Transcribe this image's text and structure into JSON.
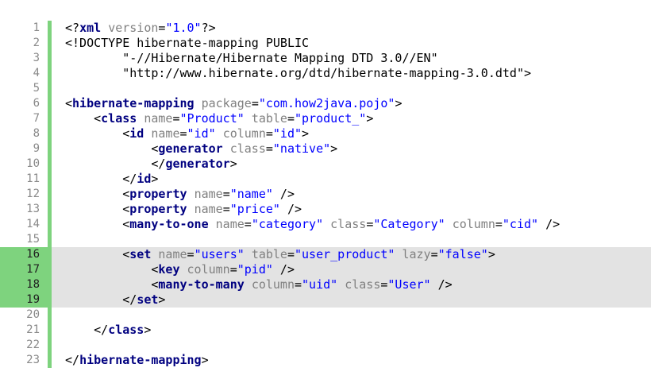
{
  "highlighted_lines": [
    16,
    17,
    18,
    19
  ],
  "colors": {
    "tag": "#000080",
    "attribute": "#808080",
    "value": "#0000ff",
    "punctuation": "#000000",
    "gutter_bar": "#7ed37e",
    "highlight_background": "#e3e3e3"
  },
  "lines": [
    {
      "n": "1",
      "tokens": [
        {
          "t": "<?",
          "c": "p"
        },
        {
          "t": "xml",
          "c": "k"
        },
        {
          "t": " ",
          "c": "p"
        },
        {
          "t": "version",
          "c": "a"
        },
        {
          "t": "=",
          "c": "p"
        },
        {
          "t": "\"1.0\"",
          "c": "v"
        },
        {
          "t": "?>",
          "c": "p"
        }
      ]
    },
    {
      "n": "2",
      "tokens": [
        {
          "t": "<!DOCTYPE hibernate-mapping PUBLIC",
          "c": "p"
        }
      ]
    },
    {
      "n": "3",
      "tokens": [
        {
          "t": "        \"-//Hibernate/Hibernate Mapping DTD 3.0//EN\"",
          "c": "p"
        }
      ]
    },
    {
      "n": "4",
      "tokens": [
        {
          "t": "        \"http://www.hibernate.org/dtd/hibernate-mapping-3.0.dtd\">",
          "c": "p"
        }
      ]
    },
    {
      "n": "5",
      "tokens": []
    },
    {
      "n": "6",
      "tokens": [
        {
          "t": "<",
          "c": "p"
        },
        {
          "t": "hibernate-mapping",
          "c": "k"
        },
        {
          "t": " ",
          "c": "p"
        },
        {
          "t": "package",
          "c": "a"
        },
        {
          "t": "=",
          "c": "p"
        },
        {
          "t": "\"com.how2java.pojo\"",
          "c": "v"
        },
        {
          "t": ">",
          "c": "p"
        }
      ]
    },
    {
      "n": "7",
      "tokens": [
        {
          "t": "    <",
          "c": "p"
        },
        {
          "t": "class",
          "c": "k"
        },
        {
          "t": " ",
          "c": "p"
        },
        {
          "t": "name",
          "c": "a"
        },
        {
          "t": "=",
          "c": "p"
        },
        {
          "t": "\"Product\"",
          "c": "v"
        },
        {
          "t": " ",
          "c": "p"
        },
        {
          "t": "table",
          "c": "a"
        },
        {
          "t": "=",
          "c": "p"
        },
        {
          "t": "\"product_\"",
          "c": "v"
        },
        {
          "t": ">",
          "c": "p"
        }
      ]
    },
    {
      "n": "8",
      "tokens": [
        {
          "t": "        <",
          "c": "p"
        },
        {
          "t": "id",
          "c": "k"
        },
        {
          "t": " ",
          "c": "p"
        },
        {
          "t": "name",
          "c": "a"
        },
        {
          "t": "=",
          "c": "p"
        },
        {
          "t": "\"id\"",
          "c": "v"
        },
        {
          "t": " ",
          "c": "p"
        },
        {
          "t": "column",
          "c": "a"
        },
        {
          "t": "=",
          "c": "p"
        },
        {
          "t": "\"id\"",
          "c": "v"
        },
        {
          "t": ">",
          "c": "p"
        }
      ]
    },
    {
      "n": "9",
      "tokens": [
        {
          "t": "            <",
          "c": "p"
        },
        {
          "t": "generator",
          "c": "k"
        },
        {
          "t": " ",
          "c": "p"
        },
        {
          "t": "class",
          "c": "a"
        },
        {
          "t": "=",
          "c": "p"
        },
        {
          "t": "\"native\"",
          "c": "v"
        },
        {
          "t": ">",
          "c": "p"
        }
      ]
    },
    {
      "n": "10",
      "tokens": [
        {
          "t": "            </",
          "c": "p"
        },
        {
          "t": "generator",
          "c": "k"
        },
        {
          "t": ">",
          "c": "p"
        }
      ]
    },
    {
      "n": "11",
      "tokens": [
        {
          "t": "        </",
          "c": "p"
        },
        {
          "t": "id",
          "c": "k"
        },
        {
          "t": ">",
          "c": "p"
        }
      ]
    },
    {
      "n": "12",
      "tokens": [
        {
          "t": "        <",
          "c": "p"
        },
        {
          "t": "property",
          "c": "k"
        },
        {
          "t": " ",
          "c": "p"
        },
        {
          "t": "name",
          "c": "a"
        },
        {
          "t": "=",
          "c": "p"
        },
        {
          "t": "\"name\"",
          "c": "v"
        },
        {
          "t": " />",
          "c": "p"
        }
      ]
    },
    {
      "n": "13",
      "tokens": [
        {
          "t": "        <",
          "c": "p"
        },
        {
          "t": "property",
          "c": "k"
        },
        {
          "t": " ",
          "c": "p"
        },
        {
          "t": "name",
          "c": "a"
        },
        {
          "t": "=",
          "c": "p"
        },
        {
          "t": "\"price\"",
          "c": "v"
        },
        {
          "t": " />",
          "c": "p"
        }
      ]
    },
    {
      "n": "14",
      "tokens": [
        {
          "t": "        <",
          "c": "p"
        },
        {
          "t": "many-to-one",
          "c": "k"
        },
        {
          "t": " ",
          "c": "p"
        },
        {
          "t": "name",
          "c": "a"
        },
        {
          "t": "=",
          "c": "p"
        },
        {
          "t": "\"category\"",
          "c": "v"
        },
        {
          "t": " ",
          "c": "p"
        },
        {
          "t": "class",
          "c": "a"
        },
        {
          "t": "=",
          "c": "p"
        },
        {
          "t": "\"Category\"",
          "c": "v"
        },
        {
          "t": " ",
          "c": "p"
        },
        {
          "t": "column",
          "c": "a"
        },
        {
          "t": "=",
          "c": "p"
        },
        {
          "t": "\"cid\"",
          "c": "v"
        },
        {
          "t": " />",
          "c": "p"
        }
      ]
    },
    {
      "n": "15",
      "tokens": []
    },
    {
      "n": "16",
      "tokens": [
        {
          "t": "        <",
          "c": "p"
        },
        {
          "t": "set",
          "c": "k"
        },
        {
          "t": " ",
          "c": "p"
        },
        {
          "t": "name",
          "c": "a"
        },
        {
          "t": "=",
          "c": "p"
        },
        {
          "t": "\"users\"",
          "c": "v"
        },
        {
          "t": " ",
          "c": "p"
        },
        {
          "t": "table",
          "c": "a"
        },
        {
          "t": "=",
          "c": "p"
        },
        {
          "t": "\"user_product\"",
          "c": "v"
        },
        {
          "t": " ",
          "c": "p"
        },
        {
          "t": "lazy",
          "c": "a"
        },
        {
          "t": "=",
          "c": "p"
        },
        {
          "t": "\"false\"",
          "c": "v"
        },
        {
          "t": ">",
          "c": "p"
        }
      ]
    },
    {
      "n": "17",
      "tokens": [
        {
          "t": "            <",
          "c": "p"
        },
        {
          "t": "key",
          "c": "k"
        },
        {
          "t": " ",
          "c": "p"
        },
        {
          "t": "column",
          "c": "a"
        },
        {
          "t": "=",
          "c": "p"
        },
        {
          "t": "\"pid\"",
          "c": "v"
        },
        {
          "t": " />",
          "c": "p"
        }
      ]
    },
    {
      "n": "18",
      "tokens": [
        {
          "t": "            <",
          "c": "p"
        },
        {
          "t": "many-to-many",
          "c": "k"
        },
        {
          "t": " ",
          "c": "p"
        },
        {
          "t": "column",
          "c": "a"
        },
        {
          "t": "=",
          "c": "p"
        },
        {
          "t": "\"uid\"",
          "c": "v"
        },
        {
          "t": " ",
          "c": "p"
        },
        {
          "t": "class",
          "c": "a"
        },
        {
          "t": "=",
          "c": "p"
        },
        {
          "t": "\"User\"",
          "c": "v"
        },
        {
          "t": " />",
          "c": "p"
        }
      ]
    },
    {
      "n": "19",
      "tokens": [
        {
          "t": "        </",
          "c": "p"
        },
        {
          "t": "set",
          "c": "k"
        },
        {
          "t": ">",
          "c": "p"
        }
      ]
    },
    {
      "n": "20",
      "tokens": []
    },
    {
      "n": "21",
      "tokens": [
        {
          "t": "    </",
          "c": "p"
        },
        {
          "t": "class",
          "c": "k"
        },
        {
          "t": ">",
          "c": "p"
        }
      ]
    },
    {
      "n": "22",
      "tokens": []
    },
    {
      "n": "23",
      "tokens": [
        {
          "t": "</",
          "c": "p"
        },
        {
          "t": "hibernate-mapping",
          "c": "k"
        },
        {
          "t": ">",
          "c": "p"
        }
      ]
    }
  ]
}
